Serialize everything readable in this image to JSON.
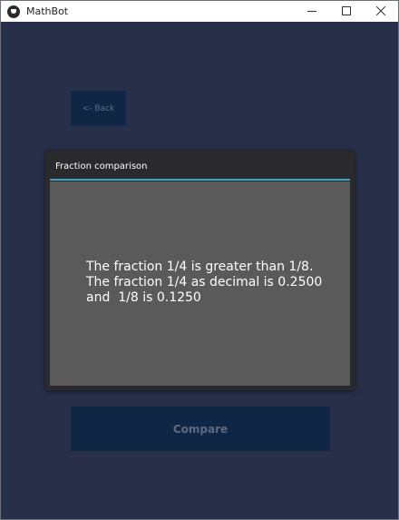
{
  "window": {
    "title": "MathBot",
    "controls": [
      "minimize-icon",
      "maximize-icon",
      "close-icon"
    ]
  },
  "back_button": {
    "label": "<- Back"
  },
  "popup": {
    "title": "Fraction comparison",
    "message": "The fraction 1/4 is greater than 1/8.\nThe fraction 1/4 as decimal is 0.2500\nand  1/8 is 0.1250"
  },
  "compare_button": {
    "label": "Compare"
  },
  "colors": {
    "background": "#283049",
    "button": "#0f2744",
    "popup_header": "#2a2a2c",
    "popup_body": "#5a5a5a",
    "accent": "#3aa6c4"
  }
}
